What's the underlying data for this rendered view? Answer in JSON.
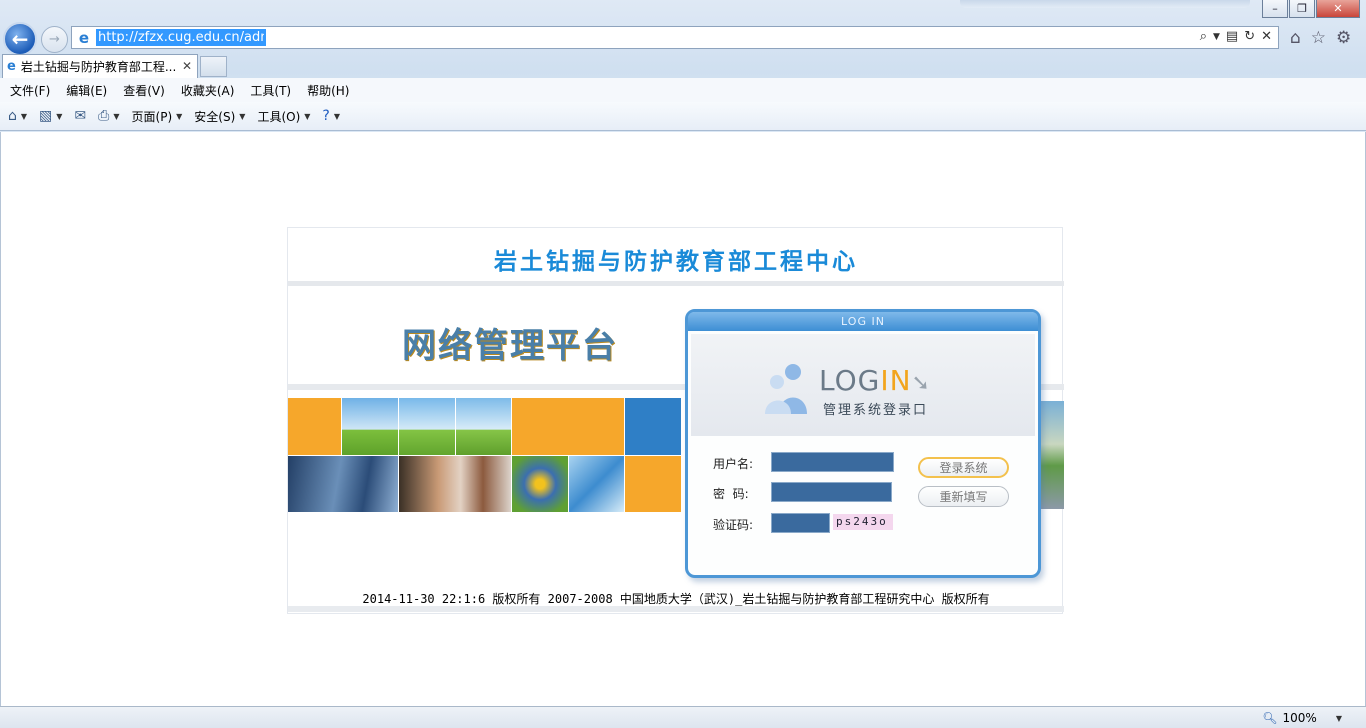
{
  "browser": {
    "url": "http://zfzx.cug.edu.cn/admin/",
    "tab_title": "岩土钻掘与防护教育部工程...",
    "menu": [
      "文件(F)",
      "编辑(E)",
      "查看(V)",
      "收藏夹(A)",
      "工具(T)",
      "帮助(H)"
    ],
    "commands": {
      "page": "页面(P)",
      "safety": "安全(S)",
      "tools": "工具(O)"
    },
    "zoom": "100%"
  },
  "site": {
    "title": "岩土钻掘与防护教育部工程中心",
    "platform": "网络管理平台",
    "copyright": "2014-11-30 22:1:6 版权所有 2007-2008  中国地质大学（武汉)_岩土钻掘与防护教育部工程研究中心  版权所有"
  },
  "login": {
    "header": "LOG IN",
    "logo_log": "LOG",
    "logo_in": "IN",
    "subtitle": "管理系统登录口",
    "username_label": "用户名:",
    "password_label": "密  码:",
    "captcha_label": "验证码:",
    "captcha_code": "ps243o",
    "login_button": "登录系统",
    "reset_button": "重新填写"
  },
  "colors": {
    "accent": "#1a8ad8",
    "login_border": "#4d97d6",
    "button_highlight": "#f3c14d"
  }
}
